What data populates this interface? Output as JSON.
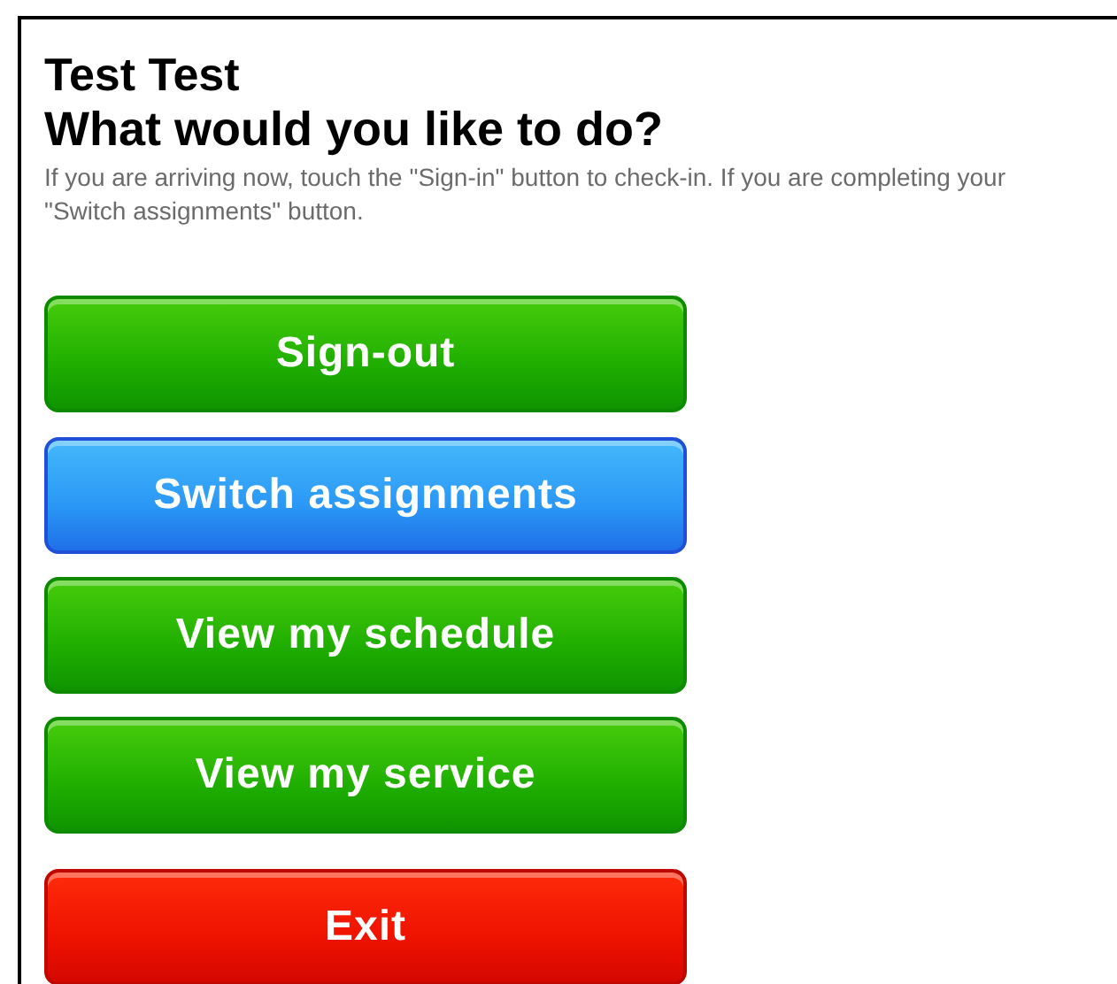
{
  "user_name": "Test Test",
  "heading": "What would you like to do?",
  "instructions": [
    "If you are arriving now, touch the \"Sign-in\" button to check-in. If you are completing your",
    "\"Switch assignments\" button."
  ],
  "buttons": [
    {
      "label": "Sign-out",
      "kind": "green"
    },
    {
      "label": "Switch assignments",
      "kind": "blue"
    },
    {
      "label": "View my schedule",
      "kind": "green"
    },
    {
      "label": "View my service",
      "kind": "green"
    },
    {
      "label": "Exit",
      "kind": "red"
    }
  ]
}
